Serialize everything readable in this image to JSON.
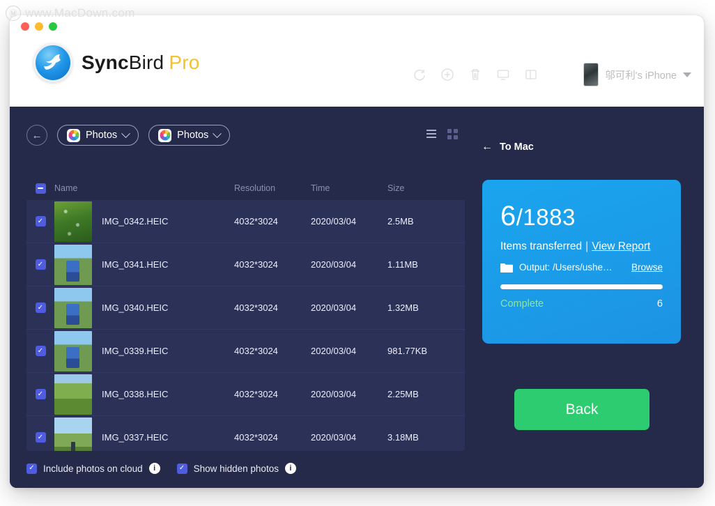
{
  "watermark": {
    "logo_icon": "m-circle-icon",
    "text": "www.MacDown.com"
  },
  "titlebar": {
    "lights": [
      "close",
      "minimize",
      "maximize"
    ],
    "brand": {
      "icon": "syncbird-logo-icon",
      "part1": "Sync",
      "part2": "Bird",
      "part3": "Pro"
    },
    "toolbar_icons": [
      {
        "name": "refresh-icon",
        "glyph": "sync"
      },
      {
        "name": "add-icon",
        "glyph": "plus-circle"
      },
      {
        "name": "trash-icon",
        "glyph": "trash"
      },
      {
        "name": "monitor-icon",
        "glyph": "display"
      },
      {
        "name": "sidebar-icon",
        "glyph": "panel"
      }
    ],
    "device": {
      "name": "邬可利's iPhone",
      "thumb_icon": "iphone-thumbnail-icon",
      "caret_icon": "chevron-down-icon"
    }
  },
  "breadcrumb": {
    "back_icon": "arrow-left-circle-icon",
    "crumb1": {
      "label": "Photos",
      "icon": "apple-photos-icon",
      "chevron": "chevron-down-icon"
    },
    "crumb2": {
      "label": "Photos",
      "icon": "apple-photos-icon",
      "chevron": "chevron-down-icon"
    }
  },
  "view_toggle": {
    "list_icon": "list-view-icon",
    "grid_icon": "grid-view-icon",
    "active": "list"
  },
  "table": {
    "header": {
      "select_all_state": "indeterminate",
      "name": "Name",
      "resolution": "Resolution",
      "time": "Time",
      "size": "Size"
    },
    "rows": [
      {
        "checked": true,
        "thumb": "th-foliage",
        "name": "IMG_0342.HEIC",
        "resolution": "4032*3024",
        "time": "2020/03/04",
        "size": "2.5MB"
      },
      {
        "checked": true,
        "thumb": "th-field",
        "name": "IMG_0341.HEIC",
        "resolution": "4032*3024",
        "time": "2020/03/04",
        "size": "1.11MB"
      },
      {
        "checked": true,
        "thumb": "th-field",
        "name": "IMG_0340.HEIC",
        "resolution": "4032*3024",
        "time": "2020/03/04",
        "size": "1.32MB"
      },
      {
        "checked": true,
        "thumb": "th-field",
        "name": "IMG_0339.HEIC",
        "resolution": "4032*3024",
        "time": "2020/03/04",
        "size": "981.77KB"
      },
      {
        "checked": true,
        "thumb": "th-green",
        "name": "IMG_0338.HEIC",
        "resolution": "4032*3024",
        "time": "2020/03/04",
        "size": "2.25MB"
      },
      {
        "checked": true,
        "thumb": "th-valley",
        "name": "IMG_0337.HEIC",
        "resolution": "4032*3024",
        "time": "2020/03/04",
        "size": "3.18MB"
      }
    ]
  },
  "options": {
    "cloud": {
      "label": "Include photos on cloud",
      "checked": true,
      "info_icon": "info-icon",
      "info_glyph": "i"
    },
    "hidden": {
      "label": "Show hidden photos",
      "checked": true,
      "info_icon": "info-icon",
      "info_glyph": "i"
    }
  },
  "right_pane": {
    "header": {
      "arrow": "←",
      "title": "To Mac"
    },
    "card": {
      "transferred": "6",
      "total": "/1883",
      "items_label": "Items transferred",
      "separator": "|",
      "report_link": "View Report",
      "folder_icon": "folder-icon",
      "output_path": "Output: /Users/ushe…",
      "browse_link": "Browse",
      "progress_percent": 100,
      "status_text": "Complete",
      "status_count": "6",
      "accent_color": "#1b9be8",
      "status_color": "#8ce6a0"
    },
    "back_button": {
      "label": "Back",
      "color": "#2ecc71"
    }
  }
}
